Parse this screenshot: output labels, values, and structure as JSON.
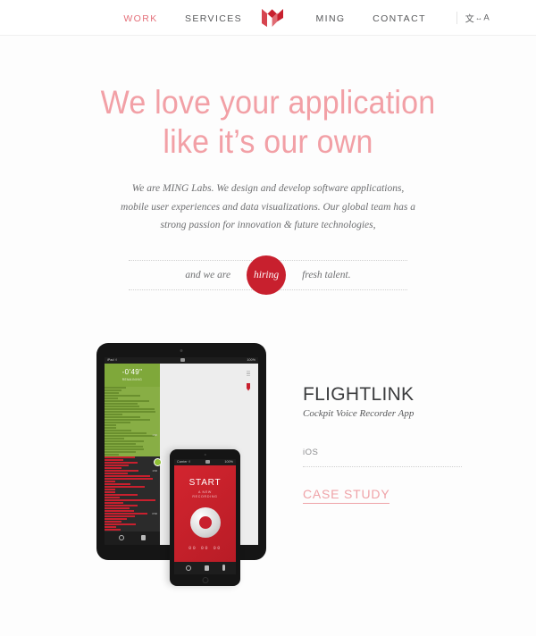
{
  "nav": {
    "items": [
      {
        "label": "WORK",
        "active": true
      },
      {
        "label": "SERVICES",
        "active": false
      },
      {
        "label": "MING",
        "active": false
      },
      {
        "label": "CONTACT",
        "active": false
      }
    ],
    "logo_name": "ming-logo",
    "logo_color": "#c8202e",
    "active_color": "#e4707a",
    "link_color": "#58595b",
    "lang": {
      "cjk": "文",
      "arrow": "↔",
      "latin": "A"
    }
  },
  "hero": {
    "headline_line1": "We love your application",
    "headline_line2": "like it’s our own",
    "headline_color": "#f2a0a6",
    "lede": "We are MING Labs. We design and develop software applications, mobile user experiences and data visualizations. Our global team has a strong passion for innovation & future technologies,",
    "hiring": {
      "before": "and we are",
      "badge": "hiring",
      "after": "fresh talent.",
      "badge_color": "#c8202e"
    }
  },
  "project": {
    "title": "FLIGHTLINK",
    "subtitle": "Cockpit Voice Recorder App",
    "platform": "iOS",
    "cta": "CASE STUDY",
    "cta_color": "#efa3a8",
    "devices": {
      "tablet": {
        "status_left": "iPad ⇧",
        "status_right": "100%",
        "track_time": "-0'49\"",
        "track_label": "REMAINING",
        "tick_labels": [
          "1'30",
          "1'00",
          "0'30"
        ]
      },
      "phone": {
        "status_left": "Carrier ⇧",
        "status_right": "100%",
        "heading": "START",
        "subheading_line1": "A NEW",
        "subheading_line2": "RECORDING",
        "timer": "00 00 00"
      }
    }
  }
}
